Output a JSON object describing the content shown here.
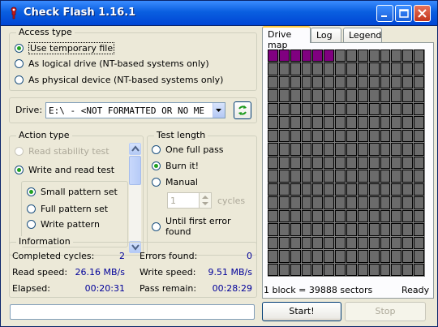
{
  "window": {
    "title": "Check Flash 1.16.1"
  },
  "access_type": {
    "label": "Access type",
    "options": [
      "Use temporary file",
      "As logical drive (NT-based systems only)",
      "As physical device (NT-based systems only)"
    ],
    "selected": "Use temporary file"
  },
  "drive": {
    "label": "Drive:",
    "value": "E:\\ - <NOT FORMATTED OR NO ME"
  },
  "action_type": {
    "label": "Action type",
    "options": [
      "Read stability test",
      "Write and read test"
    ],
    "selected": "Write and read test",
    "disabled_option": "Read stability test",
    "sub_options": [
      "Small pattern set",
      "Full pattern set",
      "Write pattern"
    ],
    "sub_selected": "Small pattern set"
  },
  "test_length": {
    "label": "Test length",
    "options": [
      "One full pass",
      "Burn it!",
      "Manual",
      "Until first error found"
    ],
    "selected": "Burn it!",
    "cycles_value": "1",
    "cycles_label": "cycles"
  },
  "information": {
    "label": "Information",
    "completed_cycles_label": "Completed cycles:",
    "completed_cycles": "2",
    "errors_found_label": "Errors found:",
    "errors_found": "0",
    "read_speed_label": "Read speed:",
    "read_speed": "26.16 MB/s",
    "write_speed_label": "Write speed:",
    "write_speed": "9.51 MB/s",
    "elapsed_label": "Elapsed:",
    "elapsed": "00:20:31",
    "pass_remain_label": "Pass remain:",
    "pass_remain": "00:28:29"
  },
  "tabs": [
    "Drive map",
    "Log",
    "Legend"
  ],
  "active_tab": "Drive map",
  "drive_map": {
    "columns": 14,
    "rows": 17,
    "written_blocks": 6,
    "written_color": "#800080",
    "empty_color": "#6B6B6B"
  },
  "status": {
    "block_info": "1 block = 39888 sectors",
    "state": "Ready"
  },
  "buttons": {
    "start": "Start!",
    "stop": "Stop"
  },
  "progress": 0
}
